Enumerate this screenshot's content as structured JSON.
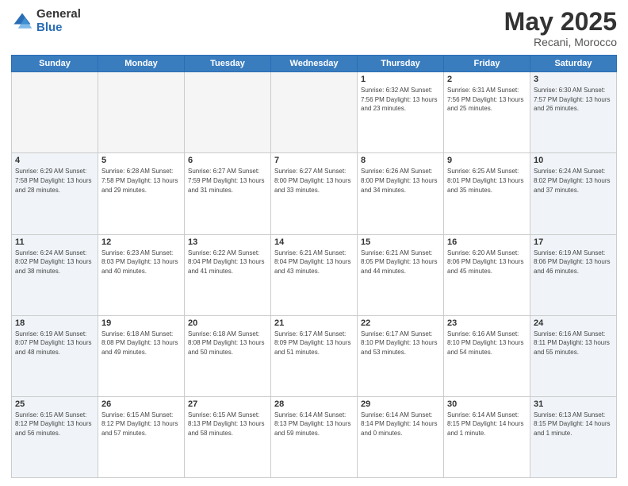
{
  "header": {
    "logo_general": "General",
    "logo_blue": "Blue",
    "month": "May 2025",
    "location": "Recani, Morocco"
  },
  "days_of_week": [
    "Sunday",
    "Monday",
    "Tuesday",
    "Wednesday",
    "Thursday",
    "Friday",
    "Saturday"
  ],
  "weeks": [
    [
      {
        "day": "",
        "info": ""
      },
      {
        "day": "",
        "info": ""
      },
      {
        "day": "",
        "info": ""
      },
      {
        "day": "",
        "info": ""
      },
      {
        "day": "1",
        "info": "Sunrise: 6:32 AM\nSunset: 7:56 PM\nDaylight: 13 hours\nand 23 minutes."
      },
      {
        "day": "2",
        "info": "Sunrise: 6:31 AM\nSunset: 7:56 PM\nDaylight: 13 hours\nand 25 minutes."
      },
      {
        "day": "3",
        "info": "Sunrise: 6:30 AM\nSunset: 7:57 PM\nDaylight: 13 hours\nand 26 minutes."
      }
    ],
    [
      {
        "day": "4",
        "info": "Sunrise: 6:29 AM\nSunset: 7:58 PM\nDaylight: 13 hours\nand 28 minutes."
      },
      {
        "day": "5",
        "info": "Sunrise: 6:28 AM\nSunset: 7:58 PM\nDaylight: 13 hours\nand 29 minutes."
      },
      {
        "day": "6",
        "info": "Sunrise: 6:27 AM\nSunset: 7:59 PM\nDaylight: 13 hours\nand 31 minutes."
      },
      {
        "day": "7",
        "info": "Sunrise: 6:27 AM\nSunset: 8:00 PM\nDaylight: 13 hours\nand 33 minutes."
      },
      {
        "day": "8",
        "info": "Sunrise: 6:26 AM\nSunset: 8:00 PM\nDaylight: 13 hours\nand 34 minutes."
      },
      {
        "day": "9",
        "info": "Sunrise: 6:25 AM\nSunset: 8:01 PM\nDaylight: 13 hours\nand 35 minutes."
      },
      {
        "day": "10",
        "info": "Sunrise: 6:24 AM\nSunset: 8:02 PM\nDaylight: 13 hours\nand 37 minutes."
      }
    ],
    [
      {
        "day": "11",
        "info": "Sunrise: 6:24 AM\nSunset: 8:02 PM\nDaylight: 13 hours\nand 38 minutes."
      },
      {
        "day": "12",
        "info": "Sunrise: 6:23 AM\nSunset: 8:03 PM\nDaylight: 13 hours\nand 40 minutes."
      },
      {
        "day": "13",
        "info": "Sunrise: 6:22 AM\nSunset: 8:04 PM\nDaylight: 13 hours\nand 41 minutes."
      },
      {
        "day": "14",
        "info": "Sunrise: 6:21 AM\nSunset: 8:04 PM\nDaylight: 13 hours\nand 43 minutes."
      },
      {
        "day": "15",
        "info": "Sunrise: 6:21 AM\nSunset: 8:05 PM\nDaylight: 13 hours\nand 44 minutes."
      },
      {
        "day": "16",
        "info": "Sunrise: 6:20 AM\nSunset: 8:06 PM\nDaylight: 13 hours\nand 45 minutes."
      },
      {
        "day": "17",
        "info": "Sunrise: 6:19 AM\nSunset: 8:06 PM\nDaylight: 13 hours\nand 46 minutes."
      }
    ],
    [
      {
        "day": "18",
        "info": "Sunrise: 6:19 AM\nSunset: 8:07 PM\nDaylight: 13 hours\nand 48 minutes."
      },
      {
        "day": "19",
        "info": "Sunrise: 6:18 AM\nSunset: 8:08 PM\nDaylight: 13 hours\nand 49 minutes."
      },
      {
        "day": "20",
        "info": "Sunrise: 6:18 AM\nSunset: 8:08 PM\nDaylight: 13 hours\nand 50 minutes."
      },
      {
        "day": "21",
        "info": "Sunrise: 6:17 AM\nSunset: 8:09 PM\nDaylight: 13 hours\nand 51 minutes."
      },
      {
        "day": "22",
        "info": "Sunrise: 6:17 AM\nSunset: 8:10 PM\nDaylight: 13 hours\nand 53 minutes."
      },
      {
        "day": "23",
        "info": "Sunrise: 6:16 AM\nSunset: 8:10 PM\nDaylight: 13 hours\nand 54 minutes."
      },
      {
        "day": "24",
        "info": "Sunrise: 6:16 AM\nSunset: 8:11 PM\nDaylight: 13 hours\nand 55 minutes."
      }
    ],
    [
      {
        "day": "25",
        "info": "Sunrise: 6:15 AM\nSunset: 8:12 PM\nDaylight: 13 hours\nand 56 minutes."
      },
      {
        "day": "26",
        "info": "Sunrise: 6:15 AM\nSunset: 8:12 PM\nDaylight: 13 hours\nand 57 minutes."
      },
      {
        "day": "27",
        "info": "Sunrise: 6:15 AM\nSunset: 8:13 PM\nDaylight: 13 hours\nand 58 minutes."
      },
      {
        "day": "28",
        "info": "Sunrise: 6:14 AM\nSunset: 8:13 PM\nDaylight: 13 hours\nand 59 minutes."
      },
      {
        "day": "29",
        "info": "Sunrise: 6:14 AM\nSunset: 8:14 PM\nDaylight: 14 hours\nand 0 minutes."
      },
      {
        "day": "30",
        "info": "Sunrise: 6:14 AM\nSunset: 8:15 PM\nDaylight: 14 hours\nand 1 minute."
      },
      {
        "day": "31",
        "info": "Sunrise: 6:13 AM\nSunset: 8:15 PM\nDaylight: 14 hours\nand 1 minute."
      }
    ]
  ]
}
